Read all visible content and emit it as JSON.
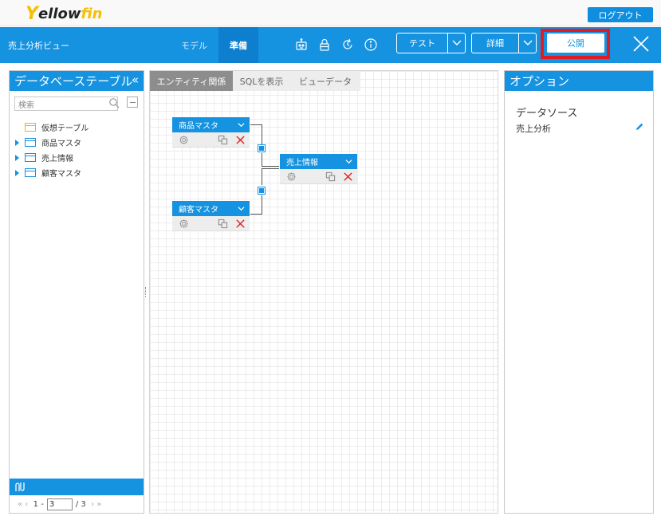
{
  "brand": {
    "logo_y": "Y",
    "logo_w1": "ellow",
    "logo_w2": "fin"
  },
  "topbar": {
    "logout_label": "ログアウト"
  },
  "header": {
    "view_title": "売上分析ビュー",
    "tabs": [
      {
        "label": "モデル"
      },
      {
        "label": "準備"
      }
    ],
    "test_label": "テスト",
    "detail_label": "詳細",
    "publish_label": "公開"
  },
  "left_panel": {
    "title": "データベーステーブル",
    "collapse_glyph": "«",
    "search_placeholder": "検索",
    "tables": [
      {
        "label": "仮想テーブル",
        "kind": "virtual"
      },
      {
        "label": "商品マスタ",
        "kind": "table"
      },
      {
        "label": "売上情報",
        "kind": "table"
      },
      {
        "label": "顧客マスタ",
        "kind": "table"
      }
    ],
    "pager": {
      "first": "«",
      "prev": "‹",
      "start": "1 -",
      "current": "3",
      "total": "/ 3",
      "next": "›",
      "last": "»"
    }
  },
  "canvas": {
    "tabs": [
      {
        "label": "エンティティ関係"
      },
      {
        "label": "SQLを表示"
      },
      {
        "label": "ビューデータ"
      }
    ],
    "entities": [
      {
        "name": "商品マスタ"
      },
      {
        "name": "売上情報"
      },
      {
        "name": "顧客マスタ"
      }
    ]
  },
  "right_panel": {
    "title": "オプション",
    "section_label": "データソース",
    "section_value": "売上分析"
  },
  "colors": {
    "primary": "#1592e0",
    "highlight": "#e21b23",
    "logo_yellow": "#f4c000",
    "delete_red": "#e02020"
  }
}
